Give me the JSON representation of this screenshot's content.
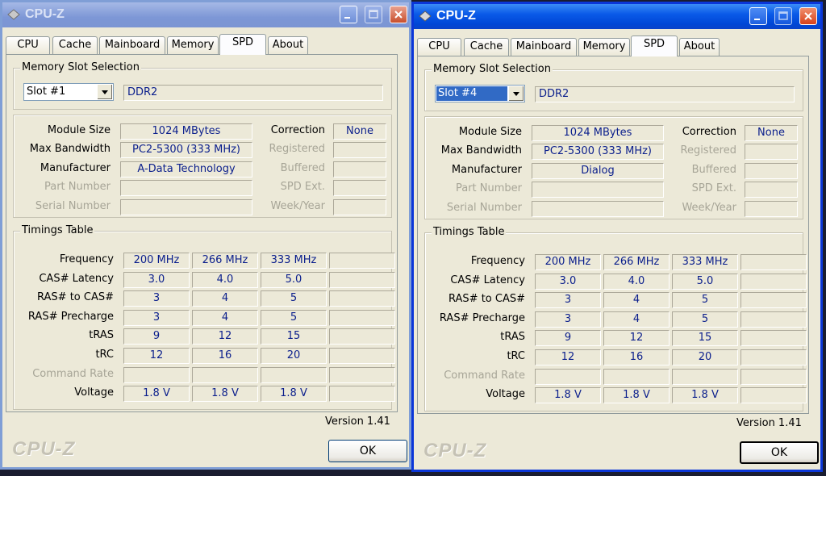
{
  "windows": [
    {
      "title": "CPU-Z",
      "tabs": [
        "CPU",
        "Cache",
        "Mainboard",
        "Memory",
        "SPD",
        "About"
      ],
      "selected_tab": "SPD",
      "slot_group_label": "Memory Slot Selection",
      "slot_value": "Slot #1",
      "memory_type": "DDR2",
      "module": {
        "size_label": "Module Size",
        "size": "1024 MBytes",
        "bandwidth_label": "Max Bandwidth",
        "bandwidth": "PC2-5300 (333 MHz)",
        "manufacturer_label": "Manufacturer",
        "manufacturer": "A-Data Technology",
        "part_label": "Part Number",
        "serial_label": "Serial Number",
        "correction_label": "Correction",
        "correction": "None",
        "registered_label": "Registered",
        "buffered_label": "Buffered",
        "spd_ext_label": "SPD Ext.",
        "week_year_label": "Week/Year"
      },
      "timings": {
        "group_label": "Timings Table",
        "row_labels": [
          "Frequency",
          "CAS# Latency",
          "RAS# to CAS#",
          "RAS# Precharge",
          "tRAS",
          "tRC",
          "Command Rate",
          "Voltage"
        ],
        "columns": [
          [
            "200 MHz",
            "3.0",
            "3",
            "3",
            "9",
            "12",
            "",
            "1.8 V"
          ],
          [
            "266 MHz",
            "4.0",
            "4",
            "4",
            "12",
            "16",
            "",
            "1.8 V"
          ],
          [
            "333 MHz",
            "5.0",
            "5",
            "5",
            "15",
            "20",
            "",
            "1.8 V"
          ],
          [
            "",
            "",
            "",
            "",
            "",
            "",
            "",
            ""
          ]
        ]
      },
      "version": "Version 1.41",
      "brand": "CPU-Z",
      "ok_label": "OK"
    },
    {
      "title": "CPU-Z",
      "tabs": [
        "CPU",
        "Cache",
        "Mainboard",
        "Memory",
        "SPD",
        "About"
      ],
      "selected_tab": "SPD",
      "slot_group_label": "Memory Slot Selection",
      "slot_value": "Slot #4",
      "memory_type": "DDR2",
      "module": {
        "size_label": "Module Size",
        "size": "1024 MBytes",
        "bandwidth_label": "Max Bandwidth",
        "bandwidth": "PC2-5300 (333 MHz)",
        "manufacturer_label": "Manufacturer",
        "manufacturer": "Dialog",
        "part_label": "Part Number",
        "serial_label": "Serial Number",
        "correction_label": "Correction",
        "correction": "None",
        "registered_label": "Registered",
        "buffered_label": "Buffered",
        "spd_ext_label": "SPD Ext.",
        "week_year_label": "Week/Year"
      },
      "timings": {
        "group_label": "Timings Table",
        "row_labels": [
          "Frequency",
          "CAS# Latency",
          "RAS# to CAS#",
          "RAS# Precharge",
          "tRAS",
          "tRC",
          "Command Rate",
          "Voltage"
        ],
        "columns": [
          [
            "200 MHz",
            "3.0",
            "3",
            "3",
            "9",
            "12",
            "",
            "1.8 V"
          ],
          [
            "266 MHz",
            "4.0",
            "4",
            "4",
            "12",
            "16",
            "",
            "1.8 V"
          ],
          [
            "333 MHz",
            "5.0",
            "5",
            "5",
            "15",
            "20",
            "",
            "1.8 V"
          ],
          [
            "",
            "",
            "",
            "",
            "",
            "",
            "",
            ""
          ]
        ]
      },
      "version": "Version 1.41",
      "brand": "CPU-Z",
      "ok_label": "OK"
    }
  ]
}
